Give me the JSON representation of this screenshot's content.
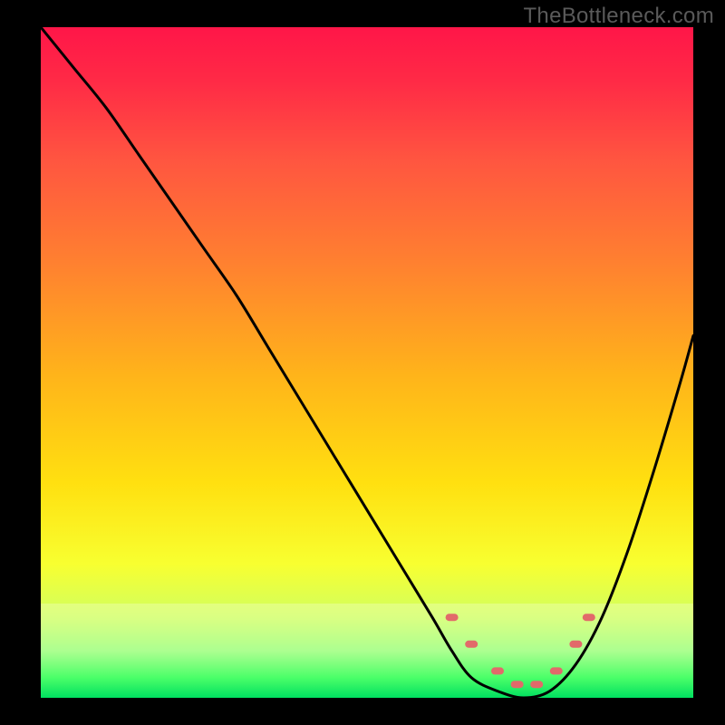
{
  "watermark": "TheBottleneck.com",
  "chart_data": {
    "type": "line",
    "title": "",
    "xlabel": "",
    "ylabel": "",
    "xlim": [
      0,
      100
    ],
    "ylim": [
      0,
      100
    ],
    "grid": false,
    "legend": false,
    "background": {
      "gradient_direction": "vertical",
      "stops": [
        {
          "pos": 0,
          "color": "#ff1648"
        },
        {
          "pos": 20,
          "color": "#ff5640"
        },
        {
          "pos": 52,
          "color": "#ffb41a"
        },
        {
          "pos": 80,
          "color": "#f8ff30"
        },
        {
          "pos": 100,
          "color": "#00e060"
        }
      ]
    },
    "series": [
      {
        "name": "bottleneck-curve",
        "color": "#000000",
        "x": [
          0,
          5,
          10,
          15,
          20,
          25,
          30,
          35,
          40,
          45,
          50,
          55,
          60,
          63,
          66,
          70,
          74,
          78,
          82,
          86,
          90,
          94,
          98,
          100
        ],
        "y": [
          100,
          94,
          88,
          81,
          74,
          67,
          60,
          52,
          44,
          36,
          28,
          20,
          12,
          7,
          3,
          1,
          0,
          1,
          5,
          12,
          22,
          34,
          47,
          54
        ]
      }
    ],
    "markers": {
      "name": "optimal-range",
      "color": "#e26a6a",
      "points": [
        {
          "x": 63,
          "y": 12
        },
        {
          "x": 66,
          "y": 8
        },
        {
          "x": 70,
          "y": 4
        },
        {
          "x": 73,
          "y": 2
        },
        {
          "x": 76,
          "y": 2
        },
        {
          "x": 79,
          "y": 4
        },
        {
          "x": 82,
          "y": 8
        },
        {
          "x": 84,
          "y": 12
        }
      ]
    }
  }
}
